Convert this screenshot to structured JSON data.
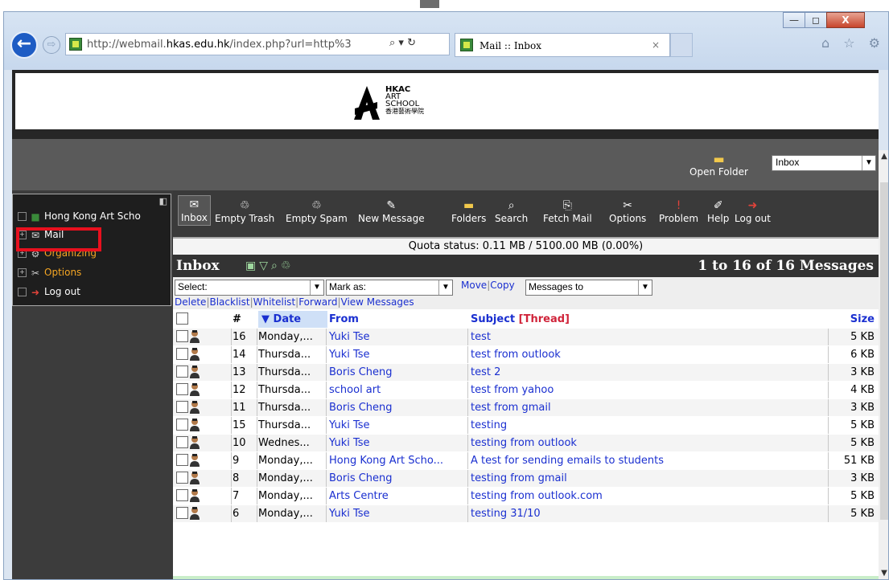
{
  "browser": {
    "url_prefix": "http://webmail.",
    "url_domain": "hkas.edu.hk",
    "url_suffix": "/index.php?url=http%3",
    "address_tools": "⌕ ▾ ↻",
    "tab_title": "Mail :: Inbox",
    "tab_close": "×",
    "back_icon": "←",
    "forward_icon": "⇨",
    "min_label": "—",
    "max_label": "◻",
    "close_label": "X",
    "home_star_gear": "⌂ ☆ ⚙"
  },
  "banner": {
    "logo_lines": [
      "HKAC",
      "ART",
      "SCHOOL",
      "香港藝術學院"
    ]
  },
  "topbar": {
    "open_folder_label": "Open Folder",
    "folder_value": "Inbox"
  },
  "tree": {
    "items": [
      {
        "label": "Hong Kong Art Scho"
      },
      {
        "label": "Mail"
      },
      {
        "label": "Organizing"
      },
      {
        "label": "Options"
      },
      {
        "label": "Log out"
      }
    ]
  },
  "toolbar": {
    "buttons": [
      {
        "label": "Inbox"
      },
      {
        "label": "Empty Trash"
      },
      {
        "label": "Empty Spam"
      },
      {
        "label": "New Message"
      },
      {
        "label": "Folders"
      },
      {
        "label": "Search"
      },
      {
        "label": "Fetch Mail"
      },
      {
        "label": "Options"
      },
      {
        "label": "Problem"
      },
      {
        "label": "Help"
      },
      {
        "label": "Log out"
      }
    ]
  },
  "quota": "Quota status: 0.11 MB / 5100.00 MB (0.00%)",
  "mailbox": {
    "title": "Inbox",
    "count_text": "1 to 16 of 16 Messages"
  },
  "actions": {
    "select_value": "Select:",
    "mark_value": "Mark as:",
    "move_label": "Move",
    "copy_label": "Copy",
    "target_value": "Messages to",
    "links": [
      "Delete",
      "Blacklist",
      "Whitelist",
      "Forward",
      "View Messages"
    ]
  },
  "table": {
    "headers": {
      "num": "#",
      "date": "▼ Date",
      "from": "From",
      "subject": "Subject",
      "thread": "[Thread]",
      "size": "Size"
    },
    "rows": [
      {
        "num": "16",
        "date": "Monday,...",
        "from": "Yuki Tse",
        "subject": "test",
        "size": "5 KB"
      },
      {
        "num": "14",
        "date": "Thursda...",
        "from": "Yuki Tse",
        "subject": "test from outlook",
        "size": "6 KB"
      },
      {
        "num": "13",
        "date": "Thursda...",
        "from": "Boris Cheng",
        "subject": "test 2",
        "size": "3 KB"
      },
      {
        "num": "12",
        "date": "Thursda...",
        "from": "school art",
        "subject": "test from yahoo",
        "size": "4 KB"
      },
      {
        "num": "11",
        "date": "Thursda...",
        "from": "Boris Cheng",
        "subject": "test from gmail",
        "size": "3 KB"
      },
      {
        "num": "15",
        "date": "Thursda...",
        "from": "Yuki Tse",
        "subject": "testing",
        "size": "5 KB"
      },
      {
        "num": "10",
        "date": "Wednes...",
        "from": "Yuki Tse",
        "subject": "testing from outlook",
        "size": "5 KB"
      },
      {
        "num": "9",
        "date": "Monday,...",
        "from": "Hong Kong Art Scho...",
        "subject": "A test for sending emails to students",
        "size": "51 KB"
      },
      {
        "num": "8",
        "date": "Monday,...",
        "from": "Boris Cheng",
        "subject": "testing from gmail",
        "size": "3 KB"
      },
      {
        "num": "7",
        "date": "Monday,...",
        "from": "Arts Centre",
        "subject": "testing from outlook.com",
        "size": "5 KB"
      },
      {
        "num": "6",
        "date": "Monday,...",
        "from": "Yuki Tse",
        "subject": "testing 31/10",
        "size": "5 KB"
      }
    ]
  }
}
